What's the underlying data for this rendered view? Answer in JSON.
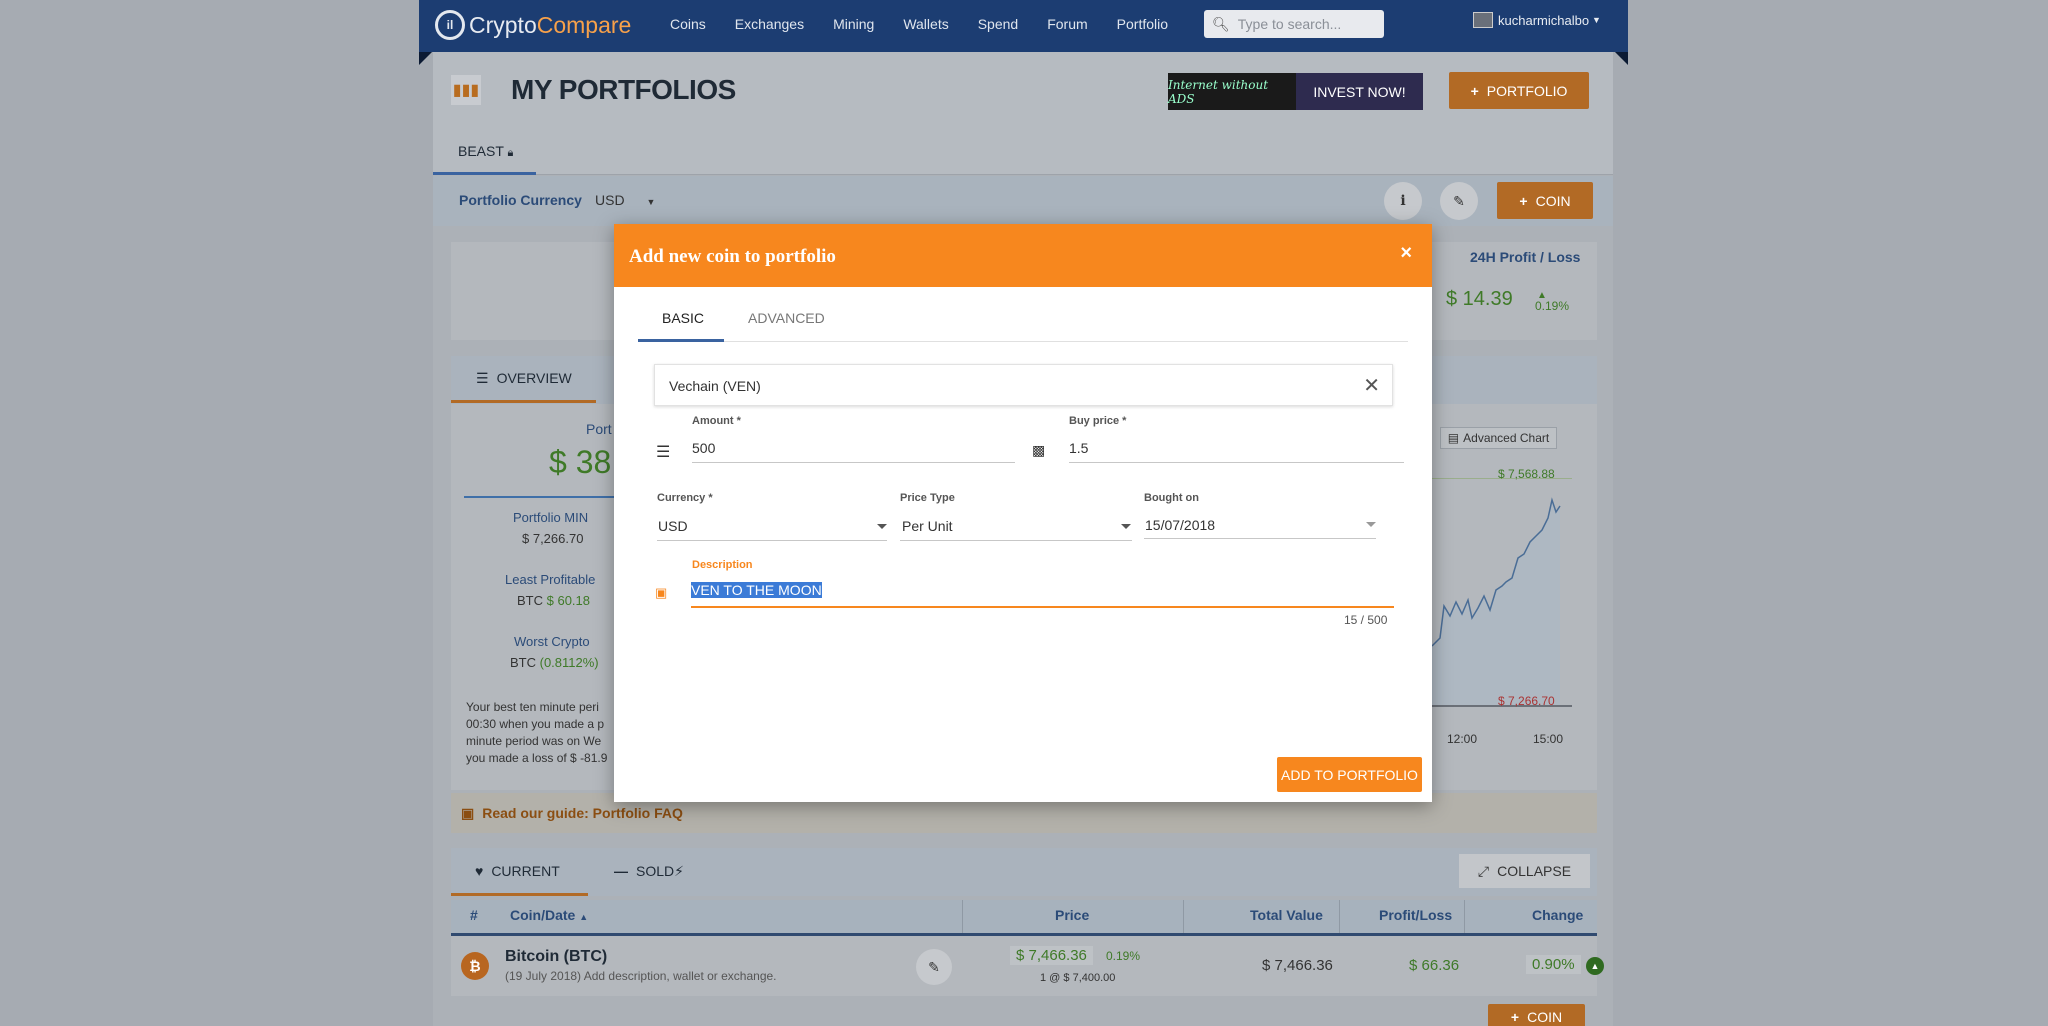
{
  "nav": {
    "logo_part1": "Crypto",
    "logo_part2": "Compare",
    "links": [
      "Coins",
      "Exchanges",
      "Mining",
      "Wallets",
      "Spend",
      "Forum",
      "Portfolio"
    ],
    "search_placeholder": "Type to search...",
    "username": "kucharmichalbo"
  },
  "header": {
    "title": "MY PORTFOLIOS",
    "ads_label": "Internet without ADS",
    "invest_label": "INVEST NOW!",
    "portfolio_button": "PORTFOLIO"
  },
  "portfolio_tab": {
    "name": "BEAST"
  },
  "currency_bar": {
    "label": "Portfolio Currency",
    "value": "USD",
    "coin_button": "COIN"
  },
  "stats": {
    "profit_title": "24H Profit / Loss",
    "profit_value": "$ 14.39",
    "profit_pct": "0.19%",
    "overview_tab": "OVERVIEW",
    "port_label": "Port",
    "port_value": "$ 38.",
    "min_label": "Portfolio MIN",
    "min_value": "$ 7,266.70",
    "least_label": "Least Profitable",
    "least_coin": "BTC",
    "least_value": "$ 60.18",
    "worst_label": "Worst Crypto",
    "worst_coin": "BTC",
    "worst_value": "(0.8112%)",
    "para1": "Your best ten minute peri",
    "para2": "00:30 when you made a p",
    "para3": "minute period was on We",
    "para4": "you made a loss of $ -81.9",
    "advanced_chart": "Advanced Chart",
    "chart_max": "$ 7,568.88",
    "chart_min": "$ 7,266.70",
    "tick1": "12:00",
    "tick2": "15:00"
  },
  "faq": {
    "text": "Read our guide: Portfolio FAQ"
  },
  "table_tabs": {
    "current": "CURRENT",
    "sold": "SOLD",
    "collapse": "COLLAPSE"
  },
  "table": {
    "headers": {
      "num": "#",
      "coin": "Coin/Date",
      "price": "Price",
      "total": "Total Value",
      "pl": "Profit/Loss",
      "change": "Change"
    },
    "row": {
      "coin": "Bitcoin (BTC)",
      "sub": "(19 July 2018) Add description, wallet or exchange.",
      "price": "$ 7,466.36",
      "price_pct": "0.19%",
      "price_sub": "1 @ $ 7,400.00",
      "total": "$ 7,466.36",
      "pl": "$ 66.36",
      "change": "0.90%"
    },
    "bottom_coin_button": "COIN"
  },
  "modal": {
    "title": "Add new coin to portfolio",
    "tab_basic": "BASIC",
    "tab_advanced": "ADVANCED",
    "coin": "Vechain (VEN)",
    "amount_label": "Amount *",
    "amount_value": "500",
    "buy_label": "Buy price *",
    "buy_value": "1.5",
    "currency_label": "Currency *",
    "currency_value": "USD",
    "price_type_label": "Price Type",
    "price_type_value": "Per Unit",
    "bought_label": "Bought on",
    "bought_value": "15/07/2018",
    "desc_label": "Description",
    "desc_value": "VEN TO THE MOON",
    "counter": "15 / 500",
    "add_button": "ADD TO PORTFOLIO"
  }
}
